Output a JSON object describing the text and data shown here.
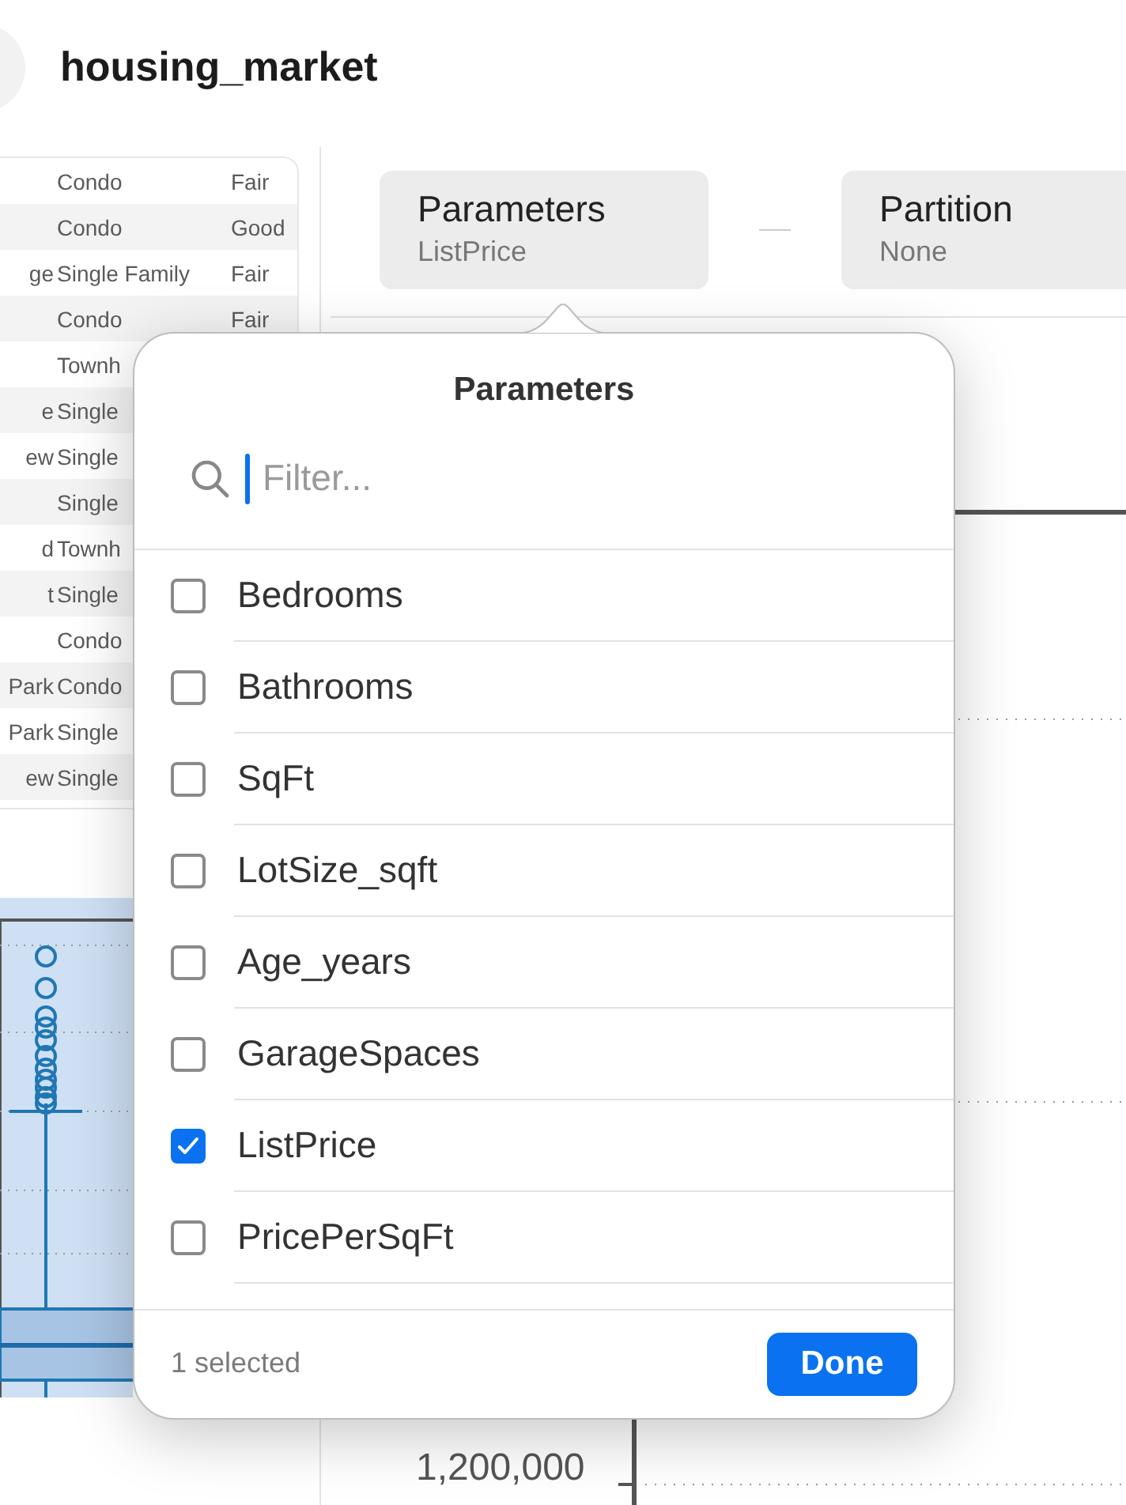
{
  "header": {
    "title": "housing_market"
  },
  "table": {
    "rows": [
      {
        "column_2": "Condo",
        "column_3": "Fair"
      },
      {
        "column_2": "Condo",
        "column_3": "Good"
      },
      {
        "column_1": "ge",
        "column_2": "Single Family",
        "column_3": "Fair"
      },
      {
        "column_2": "Condo",
        "column_3": "Fair"
      },
      {
        "column_2": "Townh"
      },
      {
        "column_1": "e",
        "column_2": "Single"
      },
      {
        "column_1": "ew",
        "column_2": "Single"
      },
      {
        "column_2": "Single"
      },
      {
        "column_1": "d",
        "column_2": "Townh"
      },
      {
        "column_1": "t",
        "column_2": "Single"
      },
      {
        "column_2": "Condo"
      },
      {
        "column_1": "Park",
        "column_2": "Condo"
      },
      {
        "column_1": "Park",
        "column_2": "Single"
      },
      {
        "column_1": "ew",
        "column_2": "Single"
      }
    ]
  },
  "pills": [
    {
      "label": "Parameters",
      "value": "ListPrice"
    },
    {
      "label": "Partition",
      "value": "None"
    }
  ],
  "chart": {
    "axis_label": "1,200,000"
  },
  "popover": {
    "title": "Parameters",
    "search": {
      "placeholder": "Filter..."
    },
    "items": [
      {
        "label": "Bedrooms",
        "checked": false
      },
      {
        "label": "Bathrooms",
        "checked": false
      },
      {
        "label": "SqFt",
        "checked": false
      },
      {
        "label": "LotSize_sqft",
        "checked": false
      },
      {
        "label": "Age_years",
        "checked": false
      },
      {
        "label": "GarageSpaces",
        "checked": false
      },
      {
        "label": "ListPrice",
        "checked": true
      },
      {
        "label": "PricePerSqFt",
        "checked": false
      }
    ],
    "status": "1 selected",
    "button": "Done"
  }
}
